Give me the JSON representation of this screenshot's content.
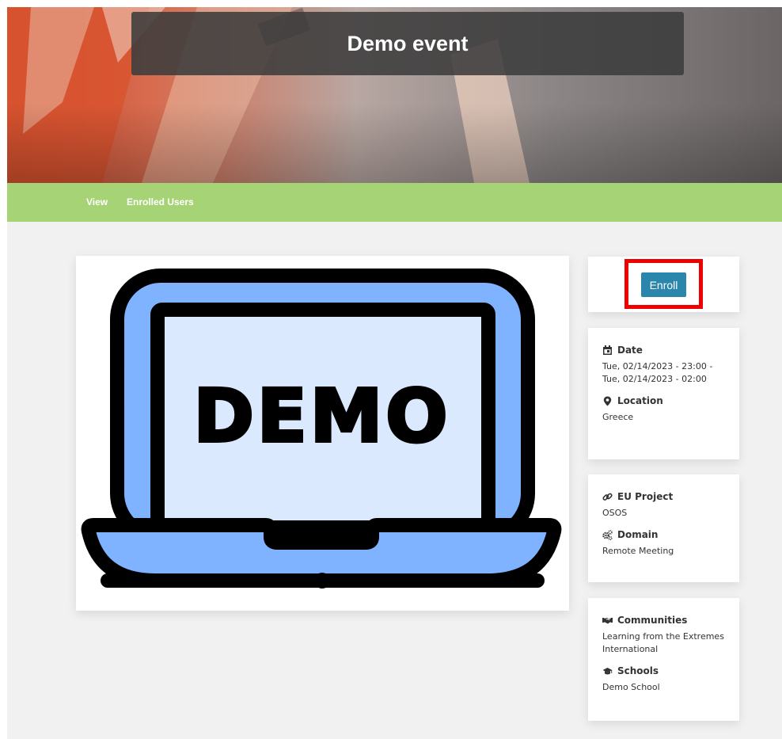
{
  "header": {
    "title": "Demo event"
  },
  "tabs": [
    {
      "label": "View"
    },
    {
      "label": "Enrolled Users"
    }
  ],
  "image": {
    "text": "DEMO"
  },
  "enroll": {
    "label": "Enroll"
  },
  "details": {
    "date": {
      "label": "Date",
      "lines": [
        "Tue, 02/14/2023 - 23:00 -",
        "Tue, 02/14/2023 - 02:00"
      ]
    },
    "location": {
      "label": "Location",
      "value": "Greece"
    },
    "eu_project": {
      "label": "EU Project",
      "value": "OSOS"
    },
    "domain": {
      "label": "Domain",
      "value": "Remote Meeting"
    },
    "communities": {
      "label": "Communities",
      "lines": [
        "Learning from the Extremes",
        "International"
      ]
    },
    "schools": {
      "label": "Schools",
      "value": "Demo School"
    }
  },
  "colors": {
    "tabbar": "#a6d376",
    "enroll_button": "#2a86ab",
    "highlight_box": "#ee0000",
    "laptop_screen": "#7fb3ff",
    "laptop_display": "#dbe9ff"
  },
  "icons": [
    "calendar-icon",
    "map-pin-icon",
    "link-icon",
    "cogs-icon",
    "handshake-icon",
    "graduation-cap-icon"
  ]
}
